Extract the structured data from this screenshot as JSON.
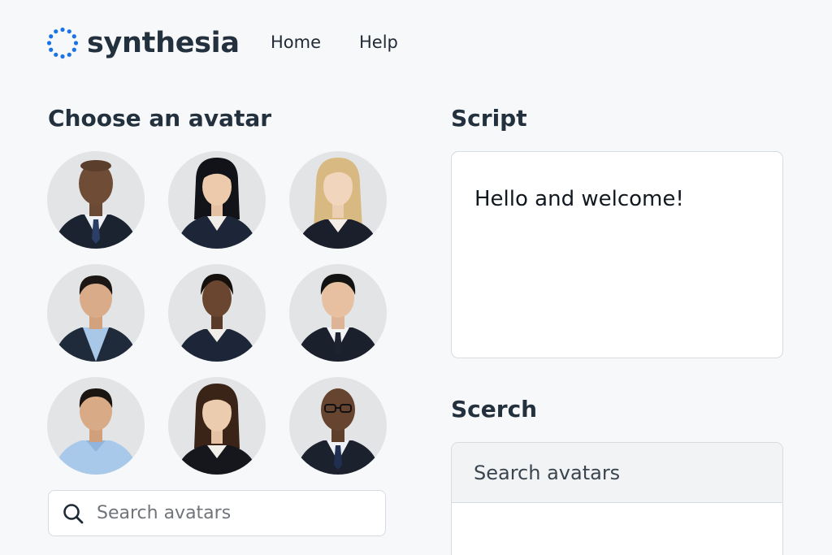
{
  "brand": {
    "name": "synthesia",
    "accent_color": "#1a73e8",
    "logo_icon": "dotted-circle-logo-icon"
  },
  "nav": {
    "items": [
      {
        "label": "Home"
      },
      {
        "label": "Help"
      }
    ]
  },
  "avatars": {
    "heading": "Choose an avatar",
    "items": [
      {
        "icon": "avatar-man-suit-tie"
      },
      {
        "icon": "avatar-woman-dark-hair"
      },
      {
        "icon": "avatar-woman-blonde"
      },
      {
        "icon": "avatar-man-light-blue-shirt"
      },
      {
        "icon": "avatar-woman-blazer"
      },
      {
        "icon": "avatar-man-tie"
      },
      {
        "icon": "avatar-man-blue-shirt"
      },
      {
        "icon": "avatar-woman-brown-hair"
      },
      {
        "icon": "avatar-man-glasses"
      }
    ],
    "search_placeholder": "Search avatars"
  },
  "script": {
    "heading": "Script",
    "text": "Hello and welcome!"
  },
  "search": {
    "heading": "Scerch",
    "placeholder": "Search avatars"
  }
}
